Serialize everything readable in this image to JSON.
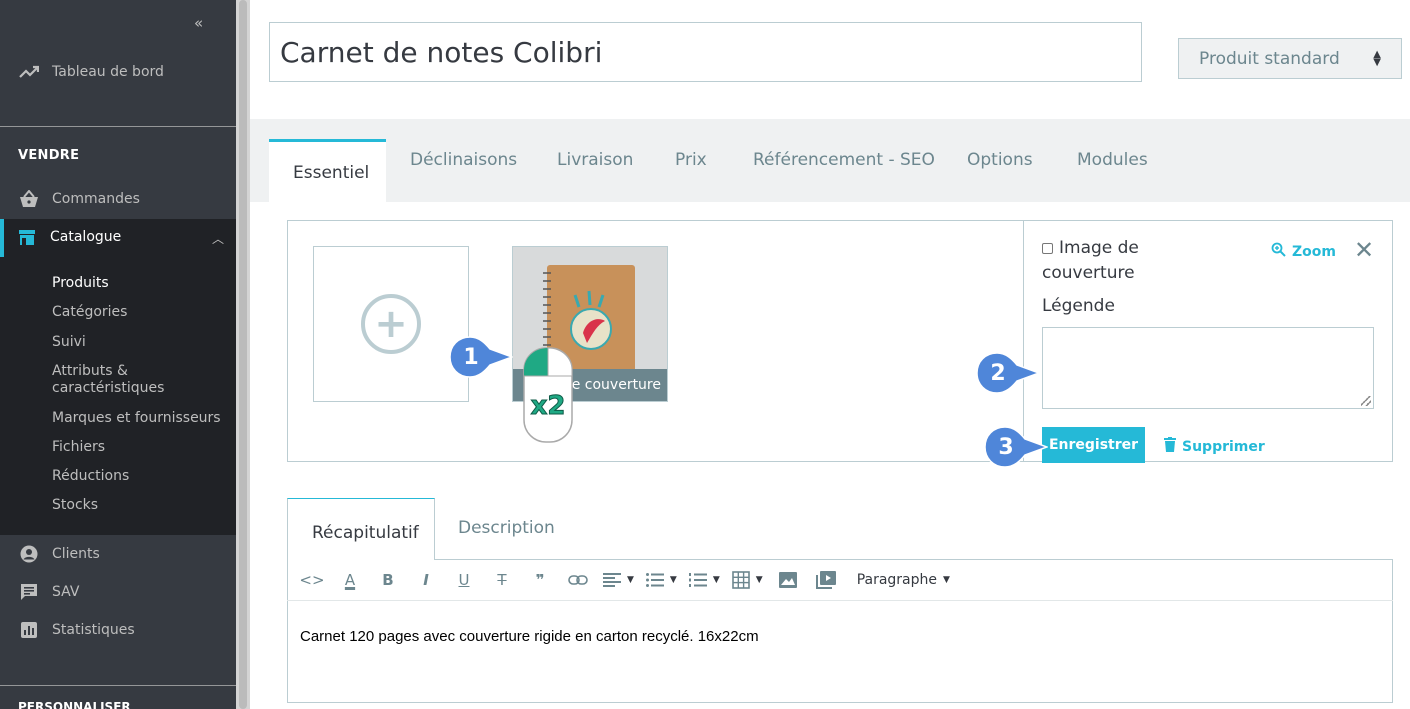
{
  "sidebar": {
    "dashboard_label": "Tableau de bord",
    "section_sell": "VENDRE",
    "orders_label": "Commandes",
    "catalog_label": "Catalogue",
    "catalog_sub": [
      "Produits",
      "Catégories",
      "Suivi",
      "Attributs &",
      "caractéristiques",
      "Marques et fournisseurs",
      "Fichiers",
      "Réductions",
      "Stocks"
    ],
    "clients_label": "Clients",
    "sav_label": "SAV",
    "stats_label": "Statistiques",
    "next_section": "PERSONNALISER"
  },
  "product": {
    "name": "Carnet de notes Colibri",
    "type": "Produit standard"
  },
  "tabs": [
    "Essentiel",
    "Déclinaisons",
    "Livraison",
    "Prix",
    "Référencement - SEO",
    "Options",
    "Modules"
  ],
  "images": {
    "cover_bar_text": "Image de couverture",
    "cover_bar_visible": "e couverture",
    "cover_check_label": "Image de couverture",
    "zoom_label": "Zoom",
    "legend_label": "Légende",
    "legend_value": "",
    "save_label": "Enregistrer",
    "delete_label": "Supprimer"
  },
  "steps": [
    "1",
    "2",
    "3"
  ],
  "mouse_label": "x2",
  "editor": {
    "tabs": [
      "Récapitulatif",
      "Description"
    ],
    "paragraph_label": "Paragraphe",
    "content": "Carnet 120 pages avec couverture rigide en carton recyclé. 16x22cm"
  },
  "colors": {
    "accent": "#25b9d7",
    "sidebar": "#363a41",
    "badge": "#4f86d9"
  }
}
